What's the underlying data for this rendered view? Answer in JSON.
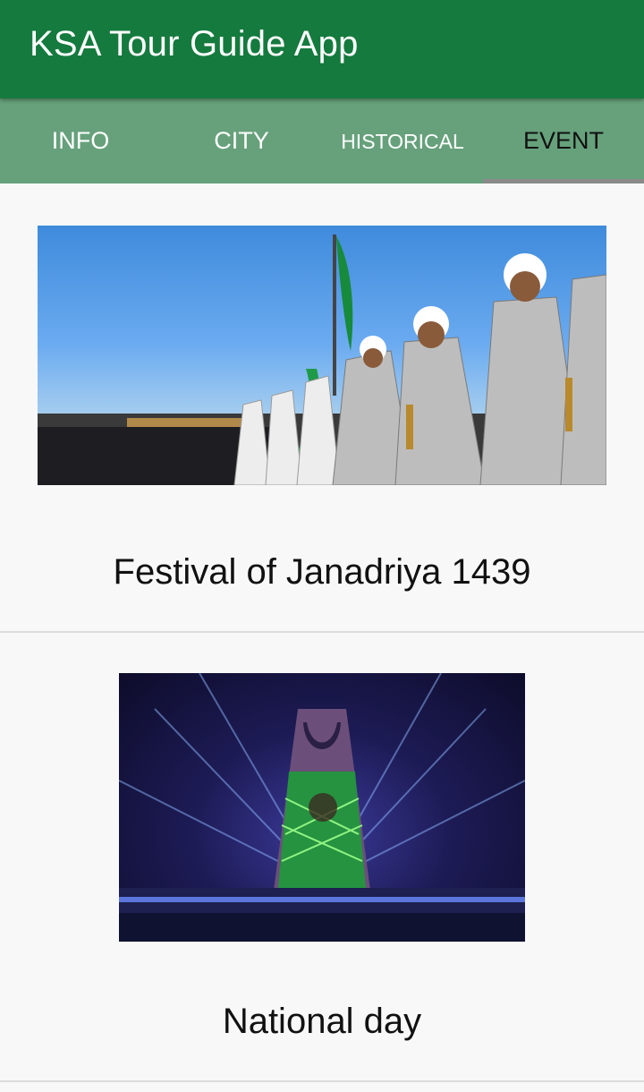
{
  "app": {
    "title": "KSA Tour Guide App"
  },
  "tabs": [
    {
      "label": "INFO",
      "active": false
    },
    {
      "label": "CITY",
      "active": false
    },
    {
      "label": "HISTORICAL",
      "active": false
    },
    {
      "label": "EVENT",
      "active": true
    }
  ],
  "events": [
    {
      "title": "Festival of Janadriya 1439",
      "image": "janadriya-festival-dancers-photo"
    },
    {
      "title": "National day",
      "image": "kingdom-tower-national-day-lights-photo"
    }
  ],
  "colors": {
    "app_bar": "#157a3e",
    "tab_bar": "#66a17b",
    "tab_indicator": "#8a8a8a",
    "background": "#f8f8f8"
  }
}
